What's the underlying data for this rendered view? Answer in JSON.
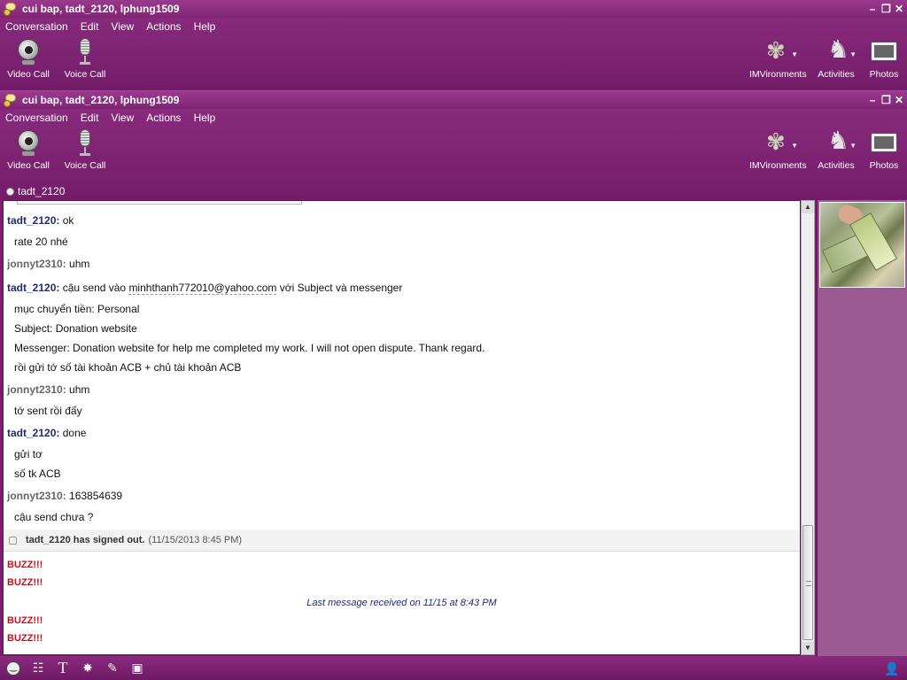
{
  "window1": {
    "title": "cui bap, tadt_2120, lphung1509",
    "menu": [
      "Conversation",
      "Edit",
      "View",
      "Actions",
      "Help"
    ],
    "toolbar": {
      "video_call": "Video Call",
      "voice_call": "Voice Call",
      "imvironments": "IMVironments",
      "activities": "Activities",
      "photos": "Photos"
    }
  },
  "window2": {
    "title": "cui bap, tadt_2120, lphung1509",
    "menu": [
      "Conversation",
      "Edit",
      "View",
      "Actions",
      "Help"
    ],
    "toolbar": {
      "video_call": "Video Call",
      "voice_call": "Voice Call",
      "imvironments": "IMVironments",
      "activities": "Activities",
      "photos": "Photos"
    },
    "contact_status": "tadt_2120"
  },
  "chat": {
    "messages": [
      {
        "sender": "tadt_2120:",
        "text": "ok"
      },
      {
        "text": "rate 20 nhé"
      },
      {
        "sender": "jonnyt2310:",
        "text": "uhm"
      },
      {
        "sender": "tadt_2120:",
        "text_before": "cậu send vào ",
        "email": "minhthanh772010@yahoo.com",
        "text_after": " với Subject và messenger"
      },
      {
        "text": "mục chuyển tiền: Personal"
      },
      {
        "text": "Subject: Donation website"
      },
      {
        "text": "Messenger: Donation website for help me completed my work. I will not open dispute. Thank regard."
      },
      {
        "text": "rồi gửi tớ số tài khoản ACB + chủ tài khoản ACB"
      },
      {
        "sender": "jonnyt2310:",
        "text": "uhm"
      },
      {
        "text": "tớ sent rồi đấy"
      },
      {
        "sender": "tadt_2120:",
        "text": "done"
      },
      {
        "text": "gửi tơ"
      },
      {
        "text": "số tk ACB"
      },
      {
        "sender": "jonnyt2310:",
        "text": "163854639"
      },
      {
        "text": "cậu send chưa ?"
      }
    ],
    "signout": {
      "text": "tadt_2120 has signed out.",
      "time": "(11/15/2013 8:45 PM)"
    },
    "buzz": "BUZZ!!!",
    "last_message": "Last message received on 11/15 at 8:43 PM"
  },
  "colors": {
    "window_purple": "#7a1f6e",
    "sender_blue": "#1e2a7a",
    "buzz_red": "#c0101a"
  },
  "icons": {
    "bottom": [
      "smiley-icon",
      "audible-icon",
      "text-format-icon",
      "nudge-icon",
      "attach-icon",
      "photo-share-icon",
      "contact-icon"
    ]
  }
}
